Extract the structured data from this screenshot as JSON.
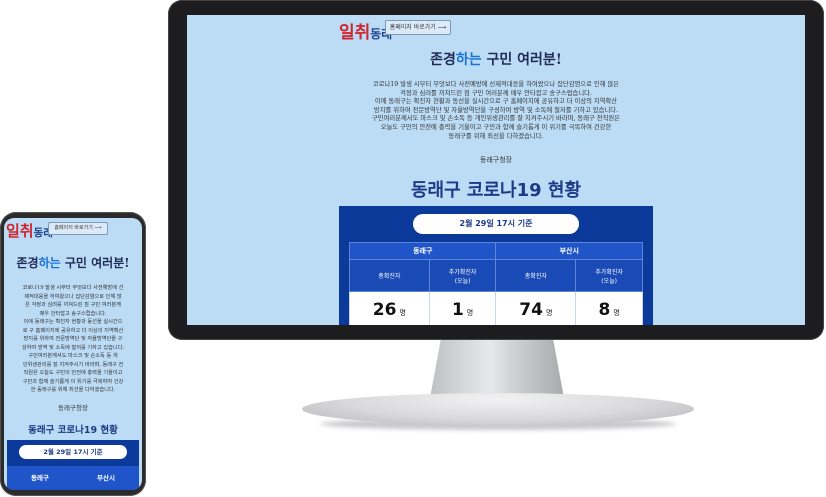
{
  "brand": {
    "logo_main": "일취",
    "logo_sub": "동래"
  },
  "nav": {
    "home_button": "홈페이지 바로가기 ⟶"
  },
  "greeting": {
    "prefix": "존경",
    "highlight": "하는",
    "suffix": " 구민 여러분!"
  },
  "message_lines": [
    "코로나19 발생 시부터 무엇보다 사전예방에 선제적대응을 하여왔으나 집단감염으로 인해 많은",
    "걱정과 심려를 끼쳐드린 점 구민 여러분께 매우 안타깝고 송구스럽습니다.",
    "이에 동래구는 확진자 현황과 동선을 실시간으로 구 홈페이지에 공유하고 더 이상의 지역확산",
    "방지를 위하여 전문방역단 및 자율방역단을 구성하여 방역 및 소독에 철저를 기하고 있습니다.",
    "구민여러분께서도 마스크 및 손소독 등 개인위생관리를 잘 지켜주시기 바라며, 동래구 전직원은",
    "오늘도 구민의 안전에 총력을 기울이고 구민과 함께 슬기롭게 이 위기를 극복하여 건강한",
    "동래구를 위해 최선을 다하겠습니다."
  ],
  "mobile_message_lines": [
    "코로나19 발생 시부터 무엇보다 사전예방에 선",
    "제적대응을 하여왔으나 집단감염으로 인해 많",
    "은 걱정과 심려를 끼쳐드린 점 구민 여러분께",
    "매우 안타깝고 송구스럽습니다.",
    "이에 동래구는 확진자 현황과 동선을 실시간으",
    "로 구 홈페이지에 공유하고 더 이상의 지역확산",
    "방지를 위하여 전문방역단 및 자율방역단을 구",
    "성하여 방역 및 소독에 철저를 기하고 있습니다.",
    "구민여러분께서도 마스크 및 손소독 등 개",
    "인위생관리를 잘 지켜주시기 바라며, 동래구 전",
    "직원은 오늘도 구민의 안전에 총력을 기울이고",
    "구민과 함께 슬기롭게 이 위기를 극복하여 건강",
    "한 동래구를 위해 최선을 다하겠습니다."
  ],
  "signature": "동래구청장",
  "status": {
    "title": "동래구 코로나19 현황",
    "date": "2월 29일 17시 기준",
    "regions": [
      {
        "name": "동래구",
        "confirmed_label": "총확진자",
        "new_label": "추가확진자",
        "new_sub": "(오늘)",
        "confirmed": "26",
        "new": "1",
        "unit": "명"
      },
      {
        "name": "부산시",
        "confirmed_label": "총확진자",
        "new_label": "추가확진자",
        "new_sub": "(오늘)",
        "confirmed": "74",
        "new": "8",
        "unit": "명"
      }
    ]
  },
  "colors": {
    "screen_bg": "#bcdcf6",
    "panel_blue": "#0b3a9a",
    "header_blue": "#1a4ab5",
    "title_navy": "#1d3a86",
    "highlight": "#1a73d2",
    "logo_red": "#d0262b"
  }
}
